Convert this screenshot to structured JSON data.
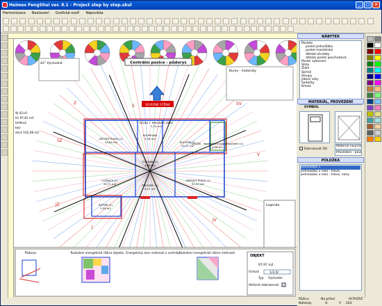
{
  "app": {
    "title": "Heimes FengShui ver. 8.1 - Project step by step.skul"
  },
  "menu": [
    "Harmonizace",
    "Nastavení",
    "Grafická osoří",
    "Nápověda"
  ],
  "colors": {
    "titlebar": "#0041b8",
    "palette": [
      "#c0c0c0",
      "#808080",
      "#000000",
      "#ffffff",
      "#800000",
      "#ff0000",
      "#808000",
      "#ffff00",
      "#008000",
      "#00ff00",
      "#008080",
      "#00ffff",
      "#000080",
      "#0000ff",
      "#800080",
      "#ff00ff",
      "#c08040",
      "#ffc080",
      "#408040",
      "#80ff80",
      "#004080",
      "#80c0ff",
      "#8040c0",
      "#ff80c0",
      "#c0c000",
      "#e0e080",
      "#40a0a0",
      "#a0e0e0",
      "#a06030",
      "#f0d0a0",
      "#606060",
      "#d0d0d0",
      "#ff8000",
      "#ffd000"
    ]
  },
  "canvas": {
    "compass_heading": "42° Východné",
    "center_title": "Centrální pozice - půdorys",
    "severni_stena": "SEVERNÍ STĚNA",
    "burey_label": "Burey - materiály",
    "legend_title": "Legenda",
    "left_notes": [
      "W 42+0",
      "lm 97,81 m2",
      "terěkvá",
      "bez",
      "ohce 102,08 m2"
    ],
    "direction_labels": [
      "SZ",
      "Z",
      "S",
      "SV",
      "V",
      "JZ",
      "J",
      "JV"
    ],
    "rooms": [
      {
        "name": "ŠATNA + PRAČKÁ S OBYV.",
        "area": "3,74 m2"
      },
      {
        "name": "DĚTSKÝ POKOJ (1)",
        "area": "13,64 m2"
      },
      {
        "name": "KOUPELNA",
        "area": "3,76 m2"
      },
      {
        "name": "KUCHYŇ (1)",
        "area": "10,11 m2"
      },
      {
        "name": "LODŽIE - Nezastřená bez proslůnění (1)",
        "area": "4,26 m2"
      },
      {
        "name": "CHODBA (1)",
        "area": "4,80 m2"
      },
      {
        "name": "LOŽNICE (1)",
        "area": "14,71 m2"
      },
      {
        "name": "PŘEDSÍŇ (1)",
        "area": "8,17 m2"
      },
      {
        "name": "OBÝVACÍ POKOJ (1)",
        "area": "32,43 m2"
      },
      {
        "name": "ŠATNÍK (1)",
        "area": "3,59 m2"
      }
    ]
  },
  "bottom": {
    "captions": [
      "Půdorys",
      "Rozložení energetické růžice objektu",
      "Energetický stav místnosti z centrály",
      "Rozložení energetické růžice místnosti"
    ],
    "objekt_title": "OBJEKT",
    "objekt_area": "97,97 m2",
    "vchod_label": "Vchod:",
    "vchod_value": "1/3 JV",
    "typ_label": "Typ",
    "typ_value": "Východní",
    "aktivni_label": "Aktivně zobrazovat"
  },
  "right_panel": {
    "header": "NÁBYTEK",
    "tree": [
      "Postele",
      "postel jednolůžko",
      "postel manželská",
      "dětské ohrádky",
      "dětská postel poschodová",
      "Postel vybavení",
      "Stoly",
      "Židle",
      "Skříně",
      "Sloupy",
      "Jídelní sety",
      "Sedačky",
      "Křesla"
    ],
    "section_material": "MATERIÁL, PROVEDENÍ",
    "symbol_label": "SYMBOL",
    "zobrazovat_3d": "Zobrazovat 3D",
    "material_value": "Materiál neurčen",
    "provedeni_value": "Provedení - povr",
    "polozka_label": "POLOŽKA",
    "polozka_items": [
      "jednolůžko 1",
      "jednolůžko 2 čelo - hlava",
      "jednolůžko 3 čelo - hlava, nohy"
    ]
  },
  "status": {
    "items": [
      "Růžice",
      "Na příkol",
      "HCP/GRZ",
      "Náhledy",
      "X:",
      "Y:",
      "243"
    ]
  }
}
